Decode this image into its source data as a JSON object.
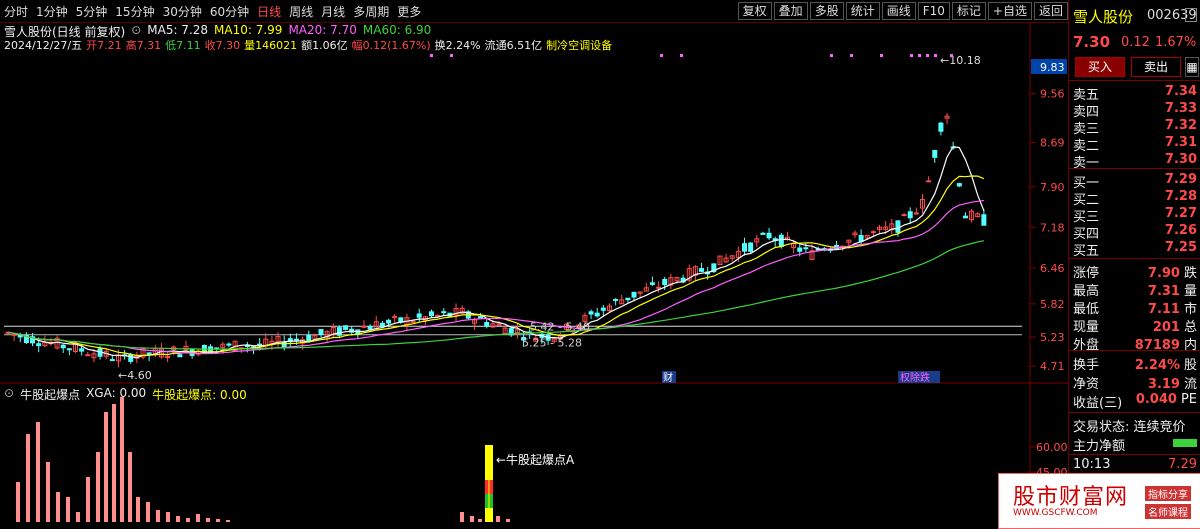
{
  "toolbar": {
    "periods": [
      "分时",
      "1分钟",
      "5分钟",
      "15分钟",
      "30分钟",
      "60分钟",
      "日线",
      "周线",
      "月线",
      "多周期",
      "更多"
    ],
    "active_period": "日线",
    "tools": [
      "复权",
      "叠加",
      "多股",
      "统计",
      "画线",
      "F10",
      "标记",
      "+自选",
      "返回"
    ]
  },
  "header": {
    "stock_title": "雪人股份(日线 前复权)",
    "ma5": "MA5: 7.28",
    "ma10": "MA10: 7.99",
    "ma20": "MA20: 7.70",
    "ma60": "MA60: 6.90"
  },
  "info": {
    "date": "2024/12/27/五",
    "open": "开7.21",
    "high": "高7.31",
    "low": "低7.11",
    "close": "收7.30",
    "volume": "量146021",
    "amount": "额1.06亿",
    "change": "幅0.12(1.67%)",
    "turnover": "换2.24%",
    "float": "流通6.51亿",
    "industry": "制冷空调设备"
  },
  "price_axis": {
    "labels": [
      "9.83",
      "9.56",
      "8.69",
      "7.90",
      "7.18",
      "6.46",
      "5.82",
      "5.23",
      "4.71"
    ],
    "highlight": "9.83"
  },
  "sub_axis": [
    "60.00",
    "45.00"
  ],
  "annotations": {
    "max": "10.18",
    "min": "4.60",
    "range1": "5.42 - 5.40",
    "range2": "5.25 - 5.28",
    "fin_mark": "财",
    "event_mark": "权",
    "event_mark2": "跌"
  },
  "indicator": {
    "name": "牛股起爆点",
    "xga": "XGA: 0.00",
    "value_label": "牛股起爆点: 0.00",
    "signal_label": "牛股起爆点A"
  },
  "quote": {
    "name": "雪人股份",
    "code": "002639",
    "price": "7.30",
    "change": "0.12",
    "pct": "1.67%",
    "buy_btn": "买入",
    "sell_btn": "卖出",
    "asks": [
      {
        "label": "卖五",
        "price": "7.34"
      },
      {
        "label": "卖四",
        "price": "7.33"
      },
      {
        "label": "卖三",
        "price": "7.32"
      },
      {
        "label": "卖二",
        "price": "7.31"
      },
      {
        "label": "卖一",
        "price": "7.30"
      }
    ],
    "bids": [
      {
        "label": "买一",
        "price": "7.29"
      },
      {
        "label": "买二",
        "price": "7.28"
      },
      {
        "label": "买三",
        "price": "7.27"
      },
      {
        "label": "买四",
        "price": "7.26"
      },
      {
        "label": "买五",
        "price": "7.25"
      }
    ],
    "stats": [
      {
        "label": "涨停",
        "value": "7.90",
        "tail": "跌"
      },
      {
        "label": "最高",
        "value": "7.31",
        "tail": "量"
      },
      {
        "label": "最低",
        "value": "7.11",
        "tail": "市"
      },
      {
        "label": "现量",
        "value": "201",
        "tail": "总"
      },
      {
        "label": "外盘",
        "value": "87189",
        "tail": "内"
      }
    ],
    "stats2": [
      {
        "label": "换手",
        "value": "2.24%",
        "tail": "股"
      },
      {
        "label": "净资",
        "value": "3.19",
        "tail": "流"
      },
      {
        "label": "收益(三)",
        "value": "0.040",
        "tail": "PE"
      }
    ],
    "trade_status": "交易状态: 连续竞价",
    "main_force": "主力净额",
    "tick_time": "10:13",
    "tick_price": "7.29"
  },
  "watermark": {
    "title": "股市财富网",
    "url": "WWW.GSCFW.COM",
    "tag1": "指标分享",
    "tag2": "名师课程"
  },
  "colors": {
    "up": "#ff4a4a",
    "down": "#54ffff",
    "ma5": "#ffffff",
    "ma10": "#ffff00",
    "ma20": "#ff60ff",
    "ma60": "#3cd23c"
  },
  "chart_data": {
    "type": "candlestick",
    "y_axis_ticks": [
      9.56,
      8.69,
      7.9,
      7.18,
      6.46,
      5.82,
      5.23,
      4.71
    ],
    "max_price": 10.18,
    "min_price": 4.6,
    "last_close": 7.3
  }
}
